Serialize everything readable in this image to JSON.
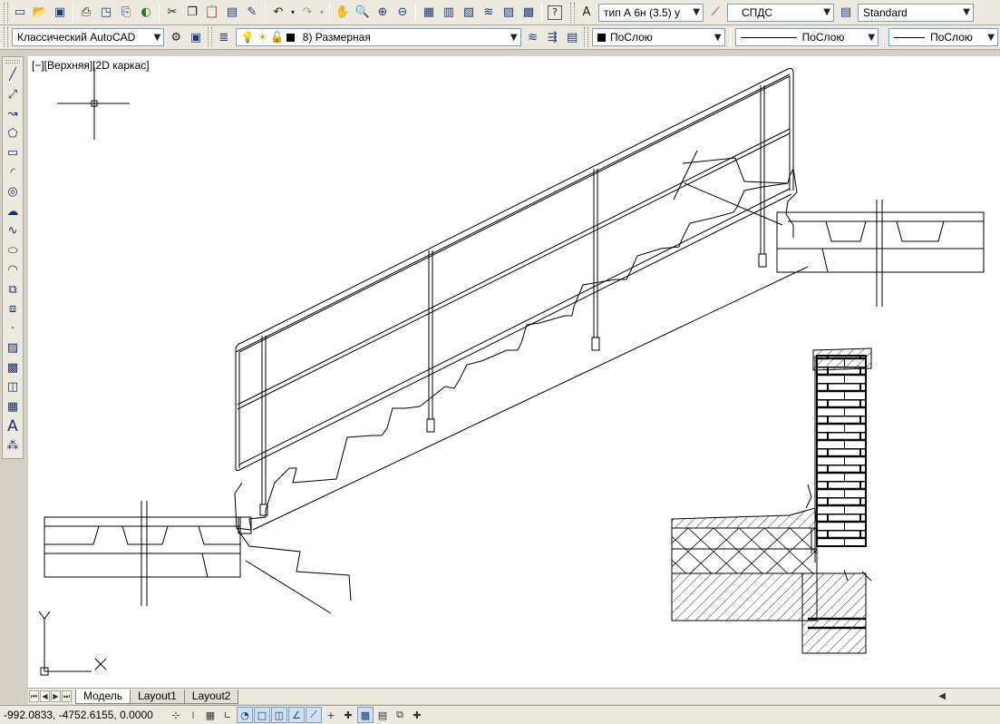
{
  "toolbar_top": {
    "text_style": "тип А 6н (3.5) у",
    "dim_style": "СПДС",
    "table_style": "Standard"
  },
  "toolbar_layers": {
    "workspace": "Классический AutoCAD",
    "layer": "8) Размерная",
    "color": "ПоСлою",
    "linetype": "ПоСлою",
    "lineweight": "ПоСлою"
  },
  "viewport": {
    "label": "[−][Верхняя][2D каркас]",
    "ucs_y": "Y",
    "ucs_x": "X"
  },
  "layout_tabs": [
    "Модель",
    "Layout1",
    "Layout2"
  ],
  "status": {
    "coordinates": "-992.0833, -4752.6155, 0.0000"
  },
  "colors": {
    "canvas_bg": "#ffffff",
    "ui_bg": "#ece9e1",
    "linework": "#000000"
  }
}
